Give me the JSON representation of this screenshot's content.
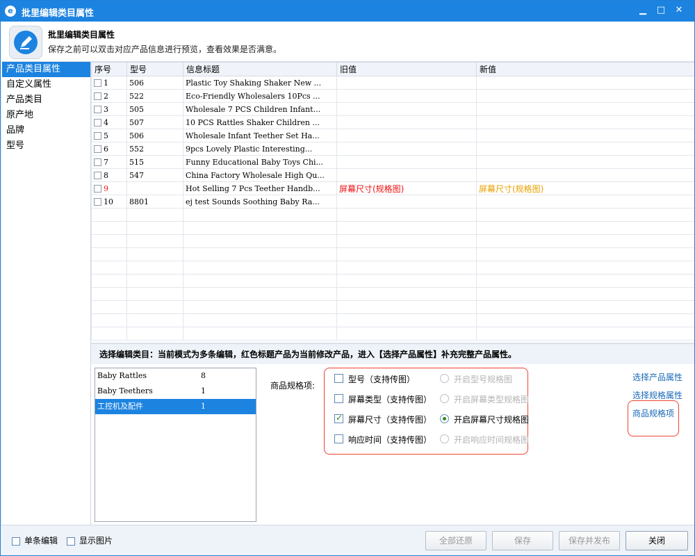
{
  "window": {
    "title": "批里编辑类目属性",
    "logo_icon": "app-logo-icon",
    "minimize_icon": "minimize-icon",
    "maximize_icon": "maximize-icon",
    "close_icon": "close-icon"
  },
  "header": {
    "title": "批里编辑类目属性",
    "subtitle": "保存之前可以双击对应产品信息进行预览，查看效果是否满意。",
    "icon": "edit-pencil-icon"
  },
  "sidebar": {
    "items": [
      {
        "label": "产品类目属性",
        "active": true
      },
      {
        "label": "自定义属性"
      },
      {
        "label": "产品类目"
      },
      {
        "label": "原产地"
      },
      {
        "label": "品牌"
      },
      {
        "label": "型号"
      }
    ]
  },
  "grid": {
    "columns": [
      "序号",
      "型号",
      "信息标题",
      "旧值",
      "新值"
    ],
    "rows": [
      {
        "no": "1",
        "model": "506",
        "title": "Plastic Toy Shaking Shaker New ...",
        "old": "",
        "new": ""
      },
      {
        "no": "2",
        "model": "522",
        "title": "Eco-Friendly Wholesalers 10Pcs ...",
        "old": "",
        "new": ""
      },
      {
        "no": "3",
        "model": "505",
        "title": "Wholesale 7 PCS Children Infant...",
        "old": "",
        "new": ""
      },
      {
        "no": "4",
        "model": "507",
        "title": "10 PCS Rattles Shaker Children ...",
        "old": "",
        "new": ""
      },
      {
        "no": "5",
        "model": "506",
        "title": "Wholesale Infant Teether Set Ha...",
        "old": "",
        "new": ""
      },
      {
        "no": "6",
        "model": "552",
        "title": "9pcs Lovely Plastic Interesting...",
        "old": "",
        "new": ""
      },
      {
        "no": "7",
        "model": "515",
        "title": "Funny Educational Baby Toys Chi...",
        "old": "",
        "new": ""
      },
      {
        "no": "8",
        "model": "547",
        "title": "China Factory Wholesale High Qu...",
        "old": "",
        "new": ""
      },
      {
        "no": "9",
        "model": "",
        "title": "Hot Selling 7 Pcs Teether Handb...",
        "old": "屏幕尺寸(规格图)",
        "new": "屏幕尺寸(规格图)",
        "highlight": true
      },
      {
        "no": "10",
        "model": "8801",
        "title": "ej test Sounds Soothing Baby Ra...",
        "old": "",
        "new": ""
      }
    ]
  },
  "hint": "选择编辑类目：当前模式为多条编辑，红色标题产品为当前修改产品，进入【选择产品属性】补充完整产品属性。",
  "categories": [
    {
      "name": "Baby Rattles",
      "count": "8"
    },
    {
      "name": "Baby Teethers",
      "count": "1"
    },
    {
      "name": "工控机及配件",
      "count": "1",
      "selected": true
    }
  ],
  "spec": {
    "label": "商品规格项:",
    "options": [
      {
        "label": "型号（支持传图）",
        "radio": "开启型号规格图",
        "checked": false,
        "radio_on": false
      },
      {
        "label": "屏幕类型（支持传图）",
        "radio": "开启屏幕类型规格图",
        "checked": false,
        "radio_on": false
      },
      {
        "label": "屏幕尺寸（支持传图）",
        "radio": "开启屏幕尺寸规格图",
        "checked": true,
        "radio_on": true
      },
      {
        "label": "响应时间（支持传图）",
        "radio": "开启响应时间规格图",
        "checked": false,
        "radio_on": false
      }
    ]
  },
  "links": {
    "select_product_attr": "选择产品属性",
    "select_spec_attr": "选择规格属性",
    "spec_items": "商品规格项"
  },
  "footer": {
    "single_edit": "单条编辑",
    "show_images": "显示图片",
    "restore_all": "全部还原",
    "save": "保存",
    "save_publish": "保存并发布",
    "close": "关闭"
  },
  "colors": {
    "accent": "#1c83e0",
    "highlight_old": "#e11111",
    "highlight_new": "#e8a000",
    "annotation": "#e43333"
  }
}
